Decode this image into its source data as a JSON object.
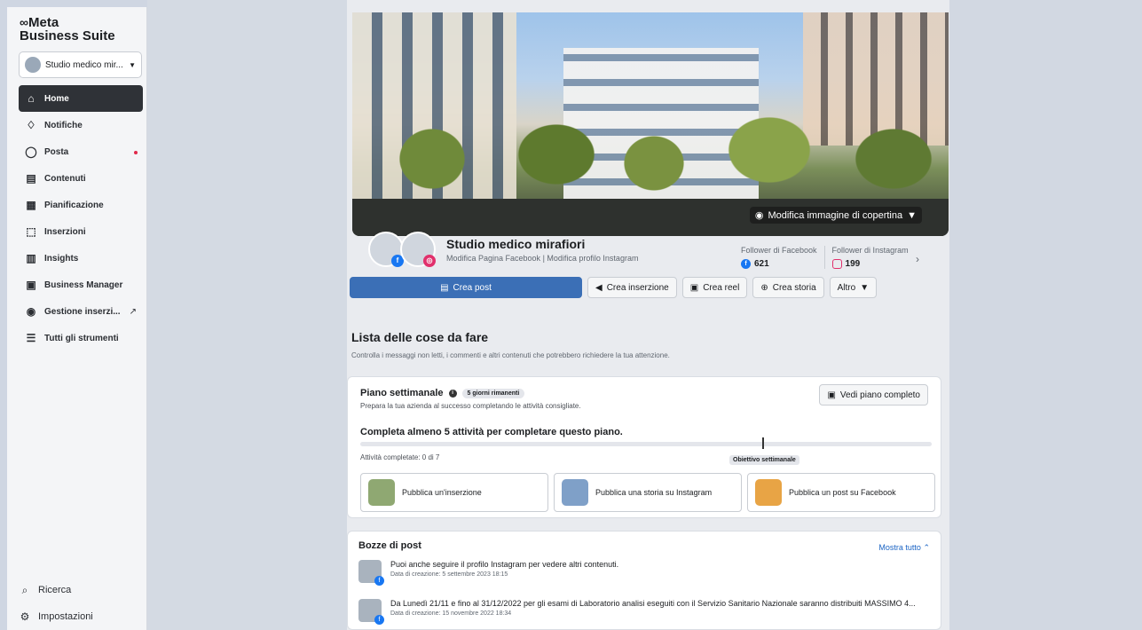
{
  "brand": {
    "line1": "Meta",
    "line2": "Business Suite",
    "symbol": "∞"
  },
  "account": {
    "name": "Studio medico mir...",
    "caret": "▼"
  },
  "nav": [
    {
      "key": "home",
      "label": "Home",
      "icon": "home-icon",
      "glyph": "⌂"
    },
    {
      "key": "notifiche",
      "label": "Notifiche",
      "icon": "bell-icon",
      "glyph": "♢"
    },
    {
      "key": "posta",
      "label": "Posta",
      "icon": "chat-icon",
      "glyph": "◯"
    },
    {
      "key": "contenuti",
      "label": "Contenuti",
      "icon": "content-icon",
      "glyph": "▤"
    },
    {
      "key": "pianificazione",
      "label": "Pianificazione",
      "icon": "calendar-icon",
      "glyph": "▦"
    },
    {
      "key": "inserzioni",
      "label": "Inserzioni",
      "icon": "megaphone-icon",
      "glyph": "⬚"
    },
    {
      "key": "insights",
      "label": "Insights",
      "icon": "chart-icon",
      "glyph": "▥"
    },
    {
      "key": "business-manager",
      "label": "Business Manager",
      "icon": "briefcase-icon",
      "glyph": "▣"
    },
    {
      "key": "gestione",
      "label": "Gestione inserzi...",
      "icon": "target-icon",
      "glyph": "◉"
    },
    {
      "key": "tutti",
      "label": "Tutti gli strumenti",
      "icon": "menu-icon",
      "glyph": "☰"
    }
  ],
  "bottom_nav": [
    {
      "key": "ricerca",
      "label": "Ricerca",
      "icon": "search-icon",
      "glyph": "⌕"
    },
    {
      "key": "impostazioni",
      "label": "Impostazioni",
      "icon": "gear-icon",
      "glyph": "⚙"
    }
  ],
  "cover": {
    "edit_label": "Modifica immagine di copertina",
    "camera": "◉",
    "caret": "▼"
  },
  "page": {
    "name": "Studio medico mirafiori",
    "links": "Modifica Pagina Facebook | Modifica profilo Instagram",
    "fb_followers_label": "Follower di Facebook",
    "fb_followers": "621",
    "ig_followers_label": "Follower di Instagram",
    "ig_followers": "199"
  },
  "actions": {
    "crea_post": "Crea post",
    "crea_inserzione": "Crea inserzione",
    "crea_reel": "Crea reel",
    "crea_storia": "Crea storia",
    "altro": "Altro"
  },
  "todo": {
    "title": "Lista delle cose da fare",
    "subtitle": "Controlla i messaggi non letti, i commenti e altri contenuti che potrebbero richiedere la tua attenzione."
  },
  "plan": {
    "title": "Piano settimanale",
    "badge": "5 giorni rimanenti",
    "subtitle": "Prepara la tua azienda al successo completando le attività consigliate.",
    "view_full": "Vedi piano completo",
    "goal_text": "Completa almeno 5 attività per completare questo piano.",
    "completed": "Attività completate: 0 di 7",
    "goal_label": "Obiettivo settimanale",
    "progress": 0,
    "tasks": [
      {
        "label": "Pubblica un'inserzione"
      },
      {
        "label": "Pubblica una storia su Instagram"
      },
      {
        "label": "Pubblica un post su Facebook"
      }
    ]
  },
  "drafts": {
    "title": "Bozze di post",
    "show_all": "Mostra tutto",
    "items": [
      {
        "text": "Puoi anche seguire il profilo Instagram per vedere altri contenuti.",
        "date": "Data di creazione: 5 settembre 2023 18:15"
      },
      {
        "text": "Da Lunedì 21/11 e fino al 31/12/2022 per gli esami di Laboratorio analisi eseguiti con il Servizio Sanitario Nazionale saranno distribuiti MASSIMO 4...",
        "date": "Data di creazione: 15 novembre 2022 18:34"
      }
    ]
  }
}
